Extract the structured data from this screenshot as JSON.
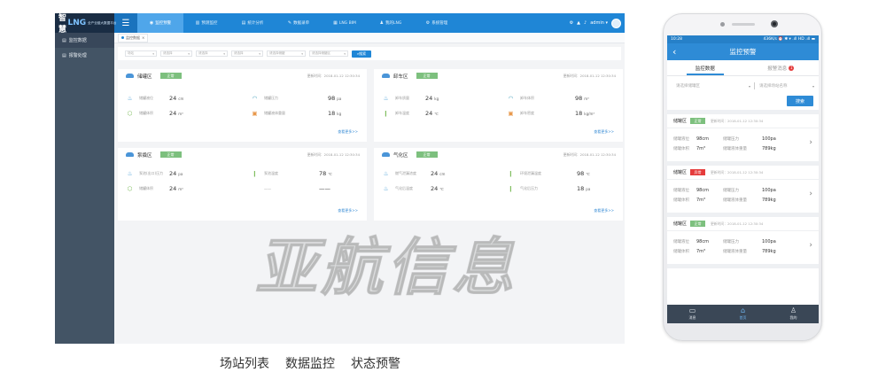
{
  "desktop": {
    "brand": {
      "part1": "智慧",
      "part2": "LNG",
      "subtitle": "全产业链大数据平台"
    },
    "nav_tabs": [
      {
        "label": "监控预警",
        "active": true
      },
      {
        "label": "预测监控"
      },
      {
        "label": "统计分析"
      },
      {
        "label": "数据录单"
      },
      {
        "label": "LNG BIM"
      },
      {
        "label": "我的LNG"
      },
      {
        "label": "系统管理"
      }
    ],
    "user": "admin ▾",
    "sidebar": [
      {
        "label": "监控数据",
        "active": true
      },
      {
        "label": "报警处理"
      }
    ],
    "breadcrumb": "监控数据",
    "filters": {
      "selects": [
        "场站",
        "请选择",
        "请选择",
        "请选择",
        "请选择储罐",
        "请选择储罐区"
      ],
      "search_button": "搜索"
    },
    "cards": [
      {
        "title": "储罐区",
        "status": "正常",
        "updated": "更新时间：2018-01-12 12:30:34",
        "metrics": [
          {
            "label": "储罐液位",
            "value": "24",
            "unit": "cm"
          },
          {
            "label": "储罐体积",
            "value": "24",
            "unit": "m³"
          },
          {
            "label": "储罐压力",
            "value": "98",
            "unit": "pa"
          },
          {
            "label": "储罐液体重量",
            "value": "18",
            "unit": "kg"
          }
        ],
        "more": "查看更多>>"
      },
      {
        "title": "卸车区",
        "status": "正常",
        "updated": "更新时间：2018-01-12 12:30:34",
        "metrics": [
          {
            "label": "卸车质量",
            "value": "24",
            "unit": "kg"
          },
          {
            "label": "卸车温度",
            "value": "24",
            "unit": "℃"
          },
          {
            "label": "卸车体积",
            "value": "98",
            "unit": "m³"
          },
          {
            "label": "卸车密度",
            "value": "18",
            "unit": "kg/m³"
          }
        ],
        "more": "查看更多>>"
      },
      {
        "title": "泵撬区",
        "status": "正常",
        "updated": "更新时间：2018-01-12 12:30:34",
        "metrics": [
          {
            "label": "泵池(出口)压力",
            "value": "24",
            "unit": "pa"
          },
          {
            "label": "储罐体积",
            "value": "24",
            "unit": "m³"
          },
          {
            "label": "泵池温度",
            "value": "78",
            "unit": "℃"
          },
          {
            "label": "——",
            "value": "——",
            "unit": ""
          }
        ],
        "more": "查看更多>>"
      },
      {
        "title": "气化区",
        "status": "正常",
        "updated": "更新时间：2018-01-12 12:30:34",
        "metrics": [
          {
            "label": "燃气泄漏浓度",
            "value": "24",
            "unit": "cm"
          },
          {
            "label": "气化后温度",
            "value": "24",
            "unit": "℃"
          },
          {
            "label": "环境泄漏温度",
            "value": "98",
            "unit": "℃"
          },
          {
            "label": "气化后压力",
            "value": "18",
            "unit": "pa"
          }
        ],
        "more": "查看更多>>"
      }
    ]
  },
  "phone": {
    "status": {
      "time": "10:28",
      "right": "436K/s ⏰ ✱ ▾ .ıll HD .ıll ▬"
    },
    "title": "监控预警",
    "back": "‹",
    "tabs": [
      {
        "label": "监控数据",
        "active": true
      },
      {
        "label": "报警消息",
        "badge": "1"
      }
    ],
    "search": {
      "select1": "请选择储罐区",
      "select2": "请选择场站名称",
      "button": "搜索"
    },
    "cards": [
      {
        "title": "储罐区",
        "status": "正常",
        "status_type": "ok",
        "updated": "更新时间：2018-01-12 12:30:34",
        "rows": [
          {
            "k1": "储罐液位",
            "v1": "98cm",
            "k2": "储罐压力",
            "v2": "100pa"
          },
          {
            "k1": "储罐体积",
            "v1": "7m³",
            "k2": "储罐液体重量",
            "v2": "789kg"
          }
        ]
      },
      {
        "title": "储罐区",
        "status": "异常",
        "status_type": "bad",
        "updated": "更新时间：2018-01-12 12:30:34",
        "rows": [
          {
            "k1": "储罐液位",
            "v1": "98cm",
            "k2": "储罐压力",
            "v2": "100pa"
          },
          {
            "k1": "储罐体积",
            "v1": "7m³",
            "k2": "储罐液体重量",
            "v2": "789kg"
          }
        ]
      },
      {
        "title": "储罐区",
        "status": "正常",
        "status_type": "ok",
        "updated": "更新时间：2018-01-12 12:30:34",
        "rows": [
          {
            "k1": "储罐液位",
            "v1": "98cm",
            "k2": "储罐压力",
            "v2": "100pa"
          },
          {
            "k1": "储罐体积",
            "v1": "7m³",
            "k2": "储罐液体重量",
            "v2": "789kg"
          }
        ]
      }
    ],
    "bottom_nav": [
      {
        "label": "消息",
        "icon": "message-icon"
      },
      {
        "label": "首页",
        "icon": "home-icon",
        "active": true
      },
      {
        "label": "我的",
        "icon": "user-icon"
      }
    ]
  },
  "watermark": "亚航信息",
  "captions": [
    "场站列表",
    "数据监控",
    "状态预警"
  ],
  "colors": {
    "primary": "#1f86d6",
    "sidebar": "#435465",
    "ok": "#7dc07e",
    "alarm": "#e53c3c"
  }
}
